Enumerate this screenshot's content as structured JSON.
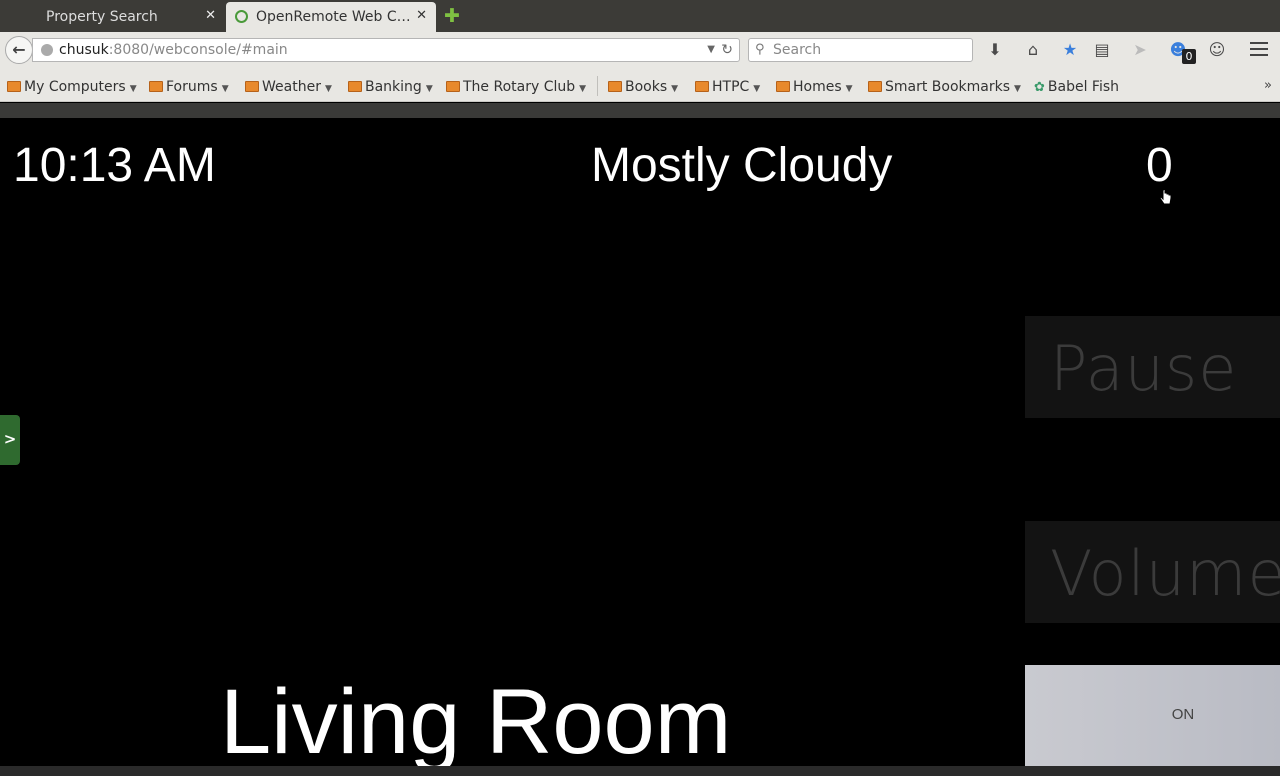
{
  "tabs": [
    {
      "title": "Property Search",
      "active": false
    },
    {
      "title": "OpenRemote Web C…",
      "active": true
    }
  ],
  "navbar": {
    "url_host": "chusuk",
    "url_rest": ":8080/webconsole/#main",
    "search_placeholder": "Search"
  },
  "extension_badge": "0",
  "bookmarks": [
    {
      "label": "My Computers",
      "type": "folder"
    },
    {
      "label": "Forums",
      "type": "folder"
    },
    {
      "label": "Weather",
      "type": "folder"
    },
    {
      "label": "Banking",
      "type": "folder"
    },
    {
      "label": "The Rotary Club",
      "type": "folder"
    },
    {
      "label": "Books",
      "type": "folder"
    },
    {
      "label": "HTPC",
      "type": "folder"
    },
    {
      "label": "Homes",
      "type": "folder"
    },
    {
      "label": "Smart Bookmarks",
      "type": "folder"
    },
    {
      "label": "Babel Fish",
      "type": "link"
    }
  ],
  "console": {
    "time": "10:13 AM",
    "weather": "Mostly Cloudy",
    "counter": "0",
    "side_toggle": ">",
    "room": "Living Room",
    "buttons": {
      "pause": "Pause",
      "volume": "Volume -",
      "on": "ON"
    }
  },
  "colors": {
    "background": "#000000",
    "text": "#ffffff",
    "tile": "#131313",
    "tile_text": "#3b3b3b",
    "side_toggle": "#2f6a2f"
  }
}
